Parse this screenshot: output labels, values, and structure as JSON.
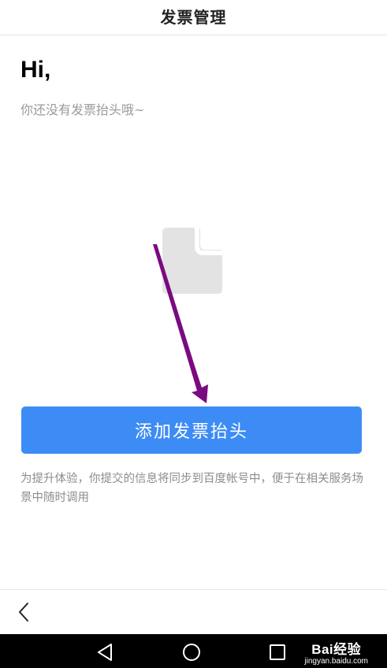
{
  "header": {
    "title": "发票管理"
  },
  "main": {
    "greeting": "Hi,",
    "empty_message": "你还没有发票抬头哦~",
    "empty_icon": "document-icon",
    "add_button_label": "添加发票抬头",
    "notice": "为提升体验，你提交的信息将同步到百度帐号中，便于在相关服务场景中随时调用"
  },
  "bottom_bar": {
    "back_icon": "chevron-left-icon"
  },
  "system_nav": {
    "back_icon": "triangle-back-icon",
    "home_icon": "circle-home-icon",
    "recents_icon": "square-recents-icon"
  },
  "watermark": {
    "logo": "Bai经验",
    "url": "jingyan.baidu.com"
  },
  "colors": {
    "accent": "#3d8cf5",
    "arrow": "#7a0a82",
    "icon_gray": "#e3e3e3"
  }
}
